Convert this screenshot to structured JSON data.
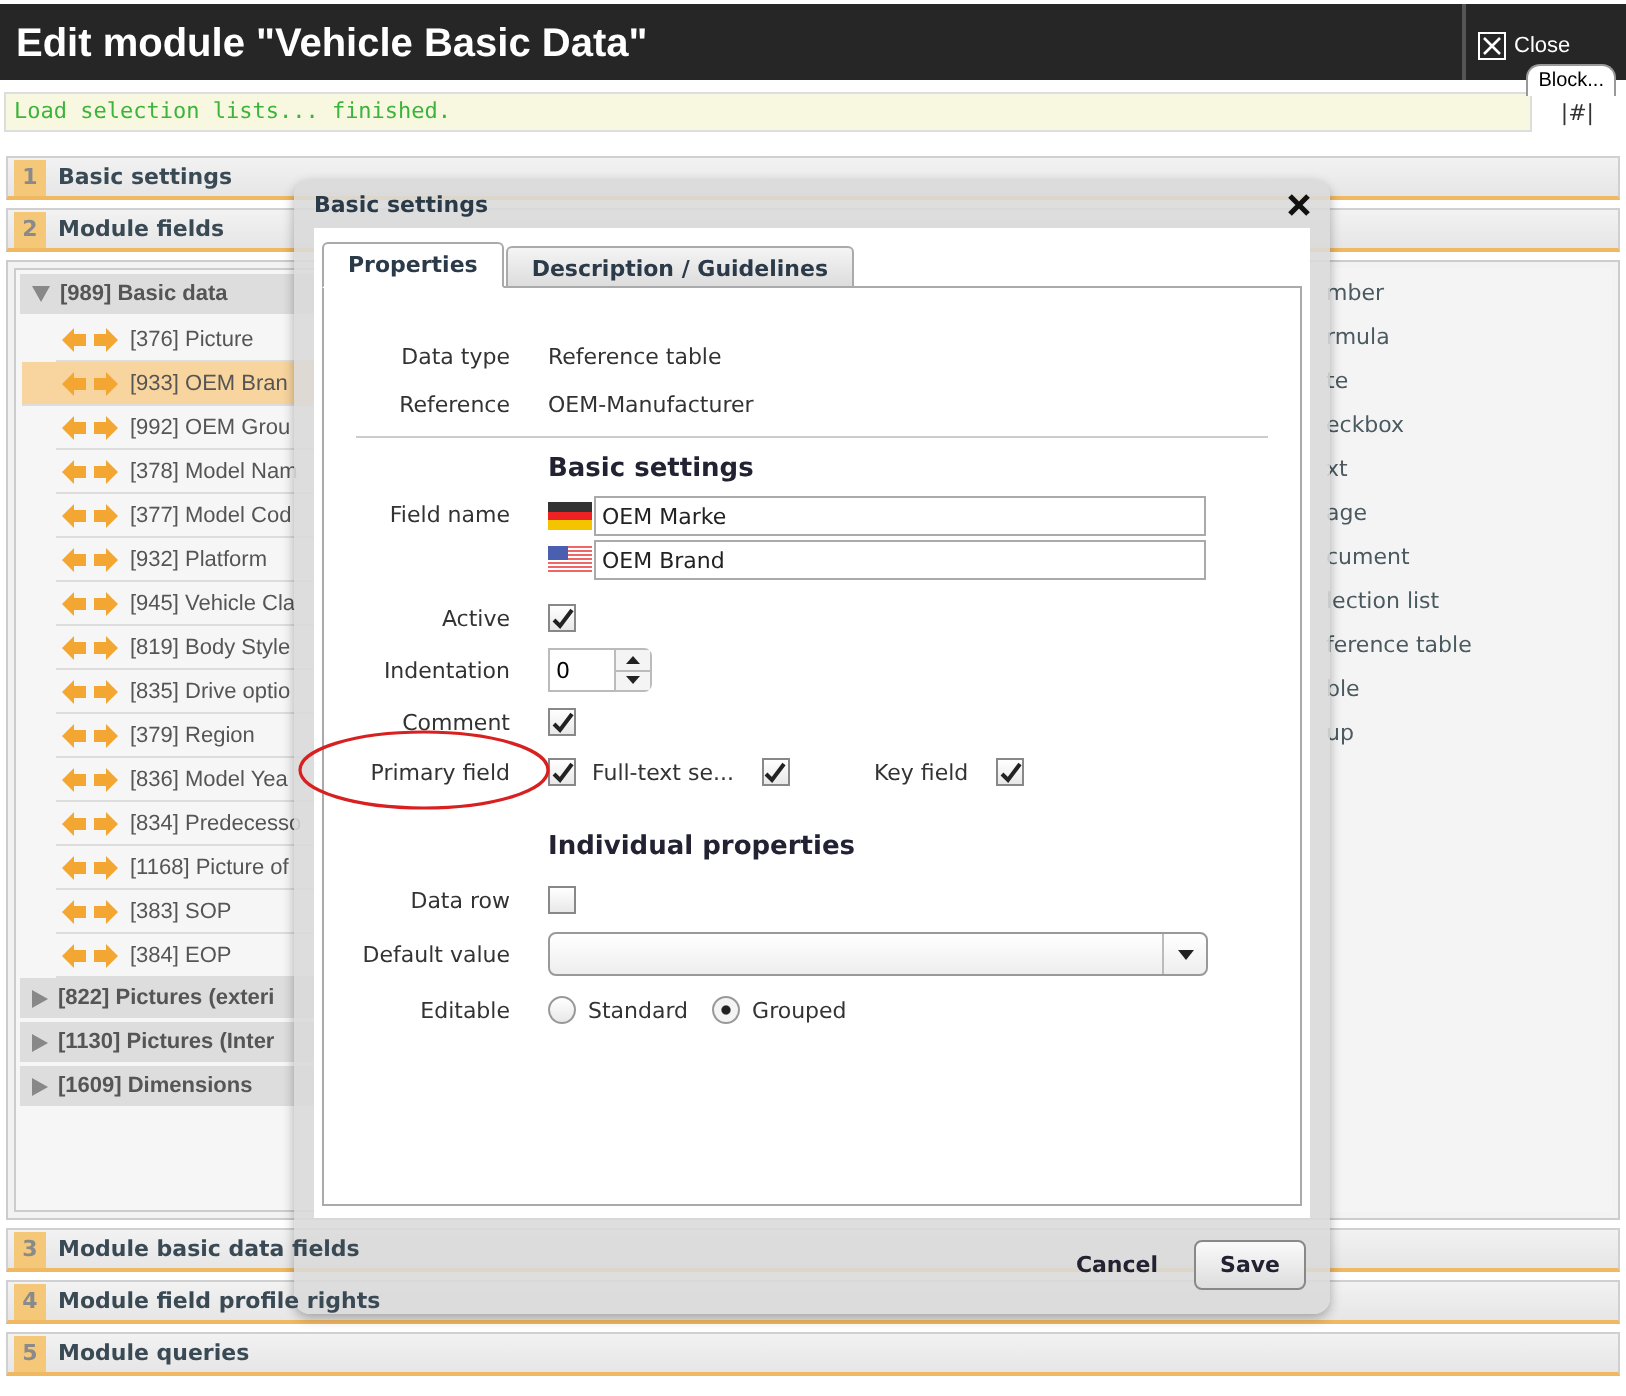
{
  "window": {
    "title": "Edit module \"Vehicle Basic Data\"",
    "close": "Close",
    "block_tab": "Block..."
  },
  "status": {
    "message": "Load selection lists... finished.",
    "anchor": "|#|"
  },
  "sections_top": [
    {
      "number": "1",
      "title": "Basic settings"
    },
    {
      "number": "2",
      "title": "Module fields"
    }
  ],
  "tree": [
    {
      "label": "[989] Basic data",
      "expanded": true,
      "children": [
        {
          "label": "[376] Picture",
          "selected": false
        },
        {
          "label": "[933] OEM Bran",
          "selected": true
        },
        {
          "label": "[992] OEM Grou",
          "selected": false
        },
        {
          "label": "[378] Model Nam",
          "selected": false
        },
        {
          "label": "[377] Model Cod",
          "selected": false
        },
        {
          "label": "[932] Platform",
          "selected": false
        },
        {
          "label": "[945] Vehicle Cla",
          "selected": false
        },
        {
          "label": "[819] Body Style",
          "selected": false
        },
        {
          "label": "[835] Drive optio",
          "selected": false
        },
        {
          "label": "[379] Region",
          "selected": false
        },
        {
          "label": "[836] Model Yea",
          "selected": false
        },
        {
          "label": "[834] Predecesso",
          "selected": false
        },
        {
          "label": "[1168] Picture of",
          "selected": false
        },
        {
          "label": "[383] SOP",
          "selected": false
        },
        {
          "label": "[384] EOP",
          "selected": false
        }
      ]
    },
    {
      "label": "[822] Pictures (exteri",
      "expanded": false
    },
    {
      "label": "[1130] Pictures (Inter",
      "expanded": false
    },
    {
      "label": "[1609] Dimensions",
      "expanded": false
    }
  ],
  "field_types": [
    "mber",
    "rmula",
    "te",
    "eckbox",
    "xt",
    "age",
    "cument",
    "lection list",
    "ference table",
    "ble",
    "up"
  ],
  "sections_bottom": [
    {
      "number": "3",
      "title": "Module basic data fields"
    },
    {
      "number": "4",
      "title": "Module field profile rights"
    },
    {
      "number": "5",
      "title": "Module queries"
    }
  ],
  "dialog": {
    "title": "Basic settings",
    "tabs": [
      {
        "label": "Properties",
        "selected": true
      },
      {
        "label": "Description / Guidelines",
        "selected": false
      }
    ],
    "info": [
      {
        "label": "Data type",
        "value": "Reference table"
      },
      {
        "label": "Reference",
        "value": "OEM-Manufacturer"
      }
    ],
    "basic_heading": "Basic settings",
    "field_name": {
      "label": "Field name",
      "values": [
        {
          "kind": "german",
          "value": "OEM Marke"
        },
        {
          "kind": "american",
          "value": "OEM Brand"
        }
      ]
    },
    "active": {
      "label": "Active",
      "checked": true
    },
    "indentation": {
      "label": "Indentation",
      "value": "0"
    },
    "comment": {
      "label": "Comment",
      "checked": true
    },
    "flags": [
      {
        "label": "Primary field",
        "checked": true,
        "circled": true
      },
      {
        "label": "Full-text se...",
        "checked": true
      },
      {
        "label": "Key field",
        "checked": true
      }
    ],
    "individual_heading": "Individual properties",
    "data_row": {
      "label": "Data row",
      "checked": false
    },
    "default_value": {
      "label": "Default value"
    },
    "editable": {
      "label": "Editable",
      "options": [
        {
          "label": "Standard",
          "selected": false
        },
        {
          "label": "Grouped",
          "selected": true
        }
      ]
    },
    "buttons": {
      "cancel": "Cancel",
      "save": "Save"
    }
  }
}
